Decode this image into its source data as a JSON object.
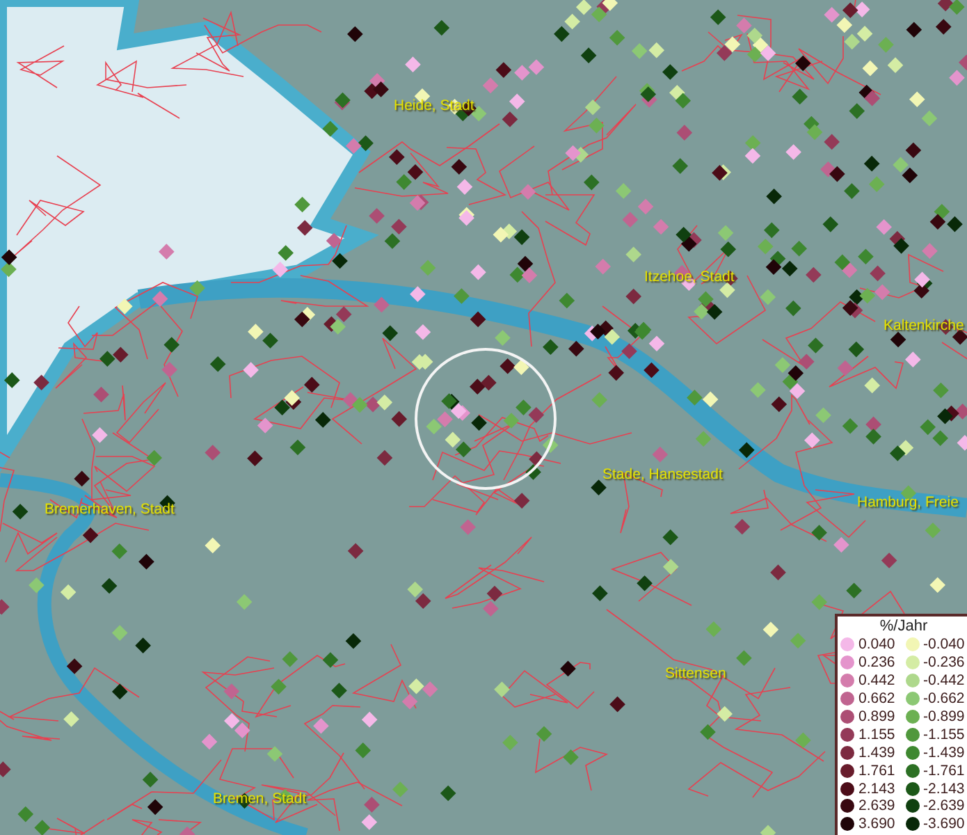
{
  "map": {
    "places": [
      {
        "name": "Heide, Stadt"
      },
      {
        "name": "Itzehoe, Stadt"
      },
      {
        "name": "Kaltenkirche"
      },
      {
        "name": "Stade, Hansestadt"
      },
      {
        "name": "Hamburg, Freie"
      },
      {
        "name": "Bremerhaven, Stadt"
      },
      {
        "name": "Sittensen"
      },
      {
        "name": "Bremen, Stadt"
      }
    ]
  },
  "legend": {
    "title": "%/Jahr",
    "positive": [
      {
        "label": "0.040",
        "color": "#f4b8e8"
      },
      {
        "label": "0.236",
        "color": "#e494cc"
      },
      {
        "label": "0.442",
        "color": "#d47cac"
      },
      {
        "label": "0.662",
        "color": "#c06490"
      },
      {
        "label": "0.899",
        "color": "#ac4e74"
      },
      {
        "label": "1.155",
        "color": "#943a58"
      },
      {
        "label": "1.439",
        "color": "#7c2a40"
      },
      {
        "label": "1.761",
        "color": "#681c2c"
      },
      {
        "label": "2.143",
        "color": "#4c0c18"
      },
      {
        "label": "2.639",
        "color": "#380810"
      },
      {
        "label": "3.690",
        "color": "#200408"
      }
    ],
    "negative": [
      {
        "label": "-0.040",
        "color": "#f2f6b4"
      },
      {
        "label": "-0.236",
        "color": "#d4eca4"
      },
      {
        "label": "-0.442",
        "color": "#aed88c"
      },
      {
        "label": "-0.662",
        "color": "#8cc874"
      },
      {
        "label": "-0.899",
        "color": "#6cb052"
      },
      {
        "label": "-1.155",
        "color": "#50983c"
      },
      {
        "label": "-1.439",
        "color": "#3e8830"
      },
      {
        "label": "-1.761",
        "color": "#2c7024"
      },
      {
        "label": "-2.143",
        "color": "#1c5818"
      },
      {
        "label": "-2.639",
        "color": "#104010"
      },
      {
        "label": "-3.690",
        "color": "#082808"
      }
    ]
  }
}
